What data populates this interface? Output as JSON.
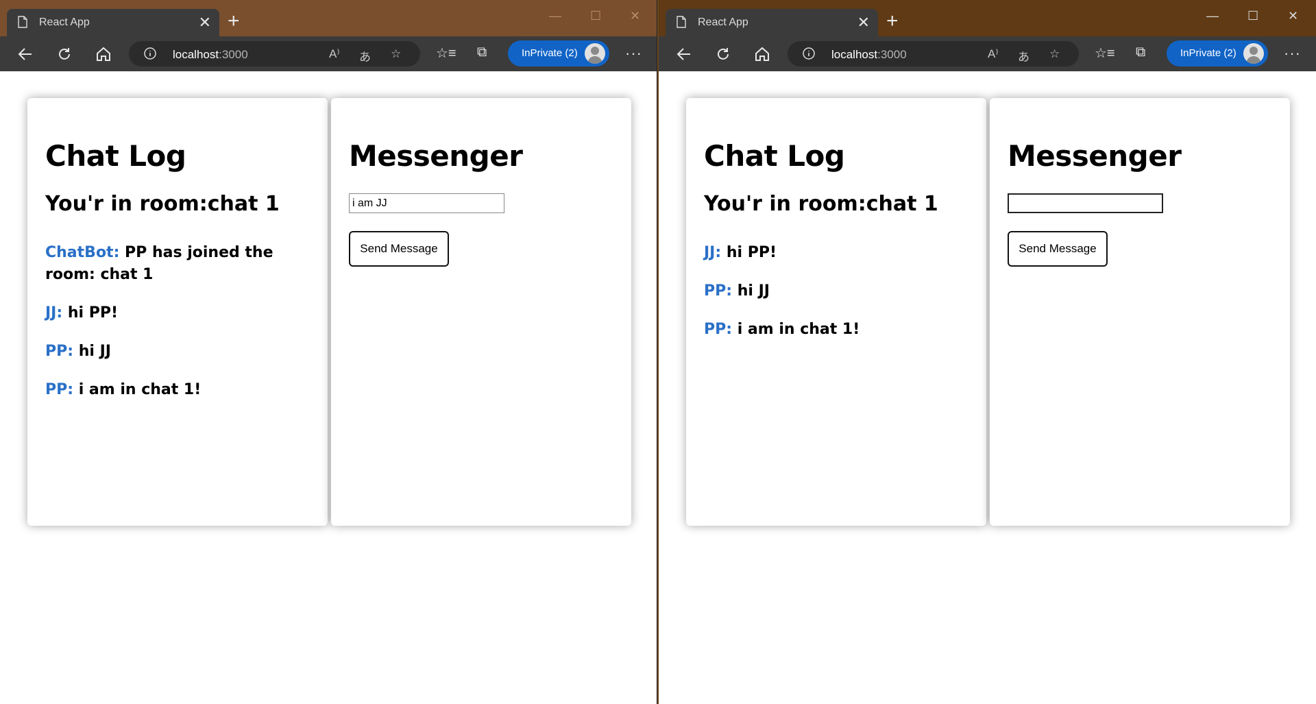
{
  "windows": [
    {
      "tab_title": "React App",
      "address_host": "localhost",
      "address_port": ":3000",
      "inprivate_label": "InPrivate (2)",
      "chat_log": {
        "title": "Chat Log",
        "room_label": "You'r in room:chat 1",
        "messages": [
          {
            "author": "ChatBot:",
            "text": "PP has joined the room: chat 1"
          },
          {
            "author": "JJ:",
            "text": "hi PP!"
          },
          {
            "author": "PP:",
            "text": "hi JJ"
          },
          {
            "author": "PP:",
            "text": "i am in chat 1!"
          }
        ]
      },
      "messenger": {
        "title": "Messenger",
        "input_value": "i am JJ",
        "send_label": "Send Message"
      }
    },
    {
      "tab_title": "React App",
      "address_host": "localhost",
      "address_port": ":3000",
      "inprivate_label": "InPrivate (2)",
      "chat_log": {
        "title": "Chat Log",
        "room_label": "You'r in room:chat 1",
        "messages": [
          {
            "author": "JJ:",
            "text": "hi PP!"
          },
          {
            "author": "PP:",
            "text": "hi JJ"
          },
          {
            "author": "PP:",
            "text": "i am in chat 1!"
          }
        ]
      },
      "messenger": {
        "title": "Messenger",
        "input_value": "",
        "send_label": "Send Message"
      }
    }
  ],
  "colors": {
    "author": "#2a70c7",
    "inprivate": "#1164c6",
    "toolbar": "#3b3b3b"
  },
  "icons": [
    "page-icon",
    "close-icon",
    "new-tab-icon",
    "minimize-icon",
    "maximize-icon",
    "back-icon",
    "refresh-icon",
    "home-icon",
    "info-icon",
    "read-aloud-icon",
    "translate-icon",
    "add-favorite-icon",
    "favorites-icon",
    "collections-icon",
    "avatar-icon",
    "more-icon"
  ]
}
